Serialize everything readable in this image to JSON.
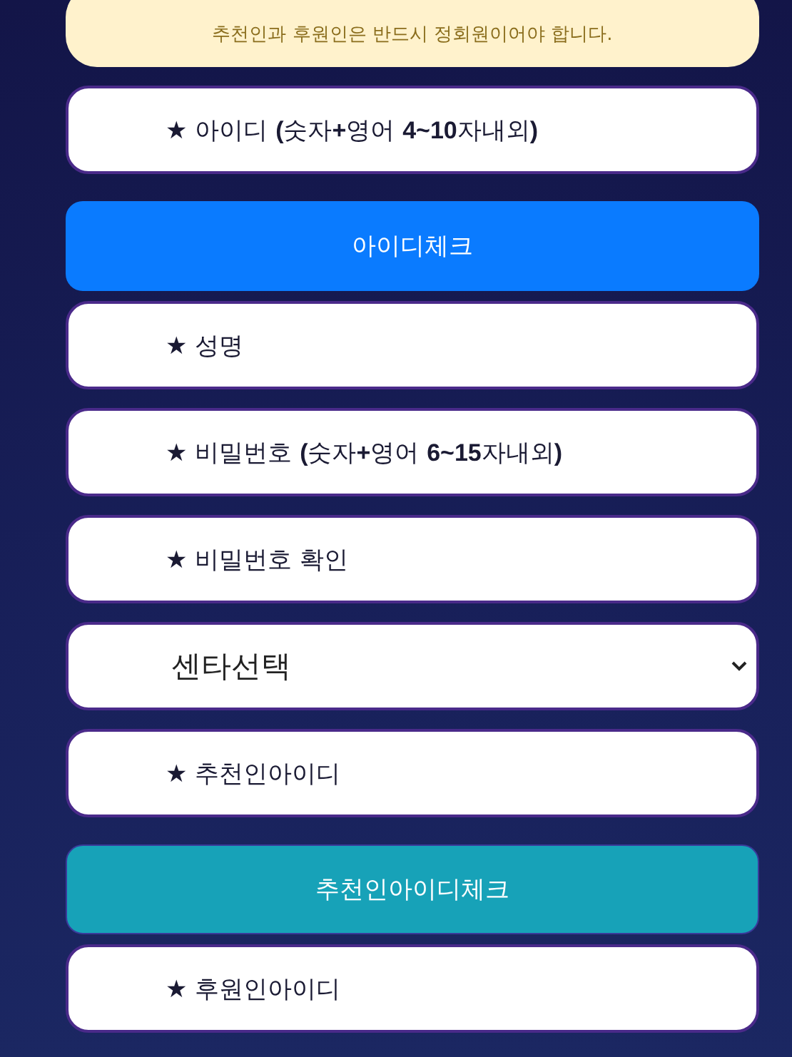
{
  "notice": {
    "text": "추천인과 후원인은 반드시 정회원이어야 합니다."
  },
  "form_items": [
    {
      "kind": "input",
      "placeholder": "★ 아이디 **(**숫자**+**영어 **4~10**자내외**)**"
    },
    {
      "kind": "primary_button",
      "label": "아이디체크"
    },
    {
      "kind": "input",
      "placeholder": "★ 성명"
    },
    {
      "kind": "input",
      "placeholder": "★ 비밀번호 **(**숫자**+**영어 **6~15**자내외**)**"
    },
    {
      "kind": "input",
      "placeholder": "★ 비밀번호 확인"
    },
    {
      "kind": "select",
      "value": "센타선택"
    },
    {
      "kind": "input",
      "placeholder": "★ 추천인아이디"
    },
    {
      "kind": "info_button",
      "label": "추천인아이디체크"
    },
    {
      "kind": "input",
      "placeholder": "★ 후원인아이디"
    }
  ]
}
